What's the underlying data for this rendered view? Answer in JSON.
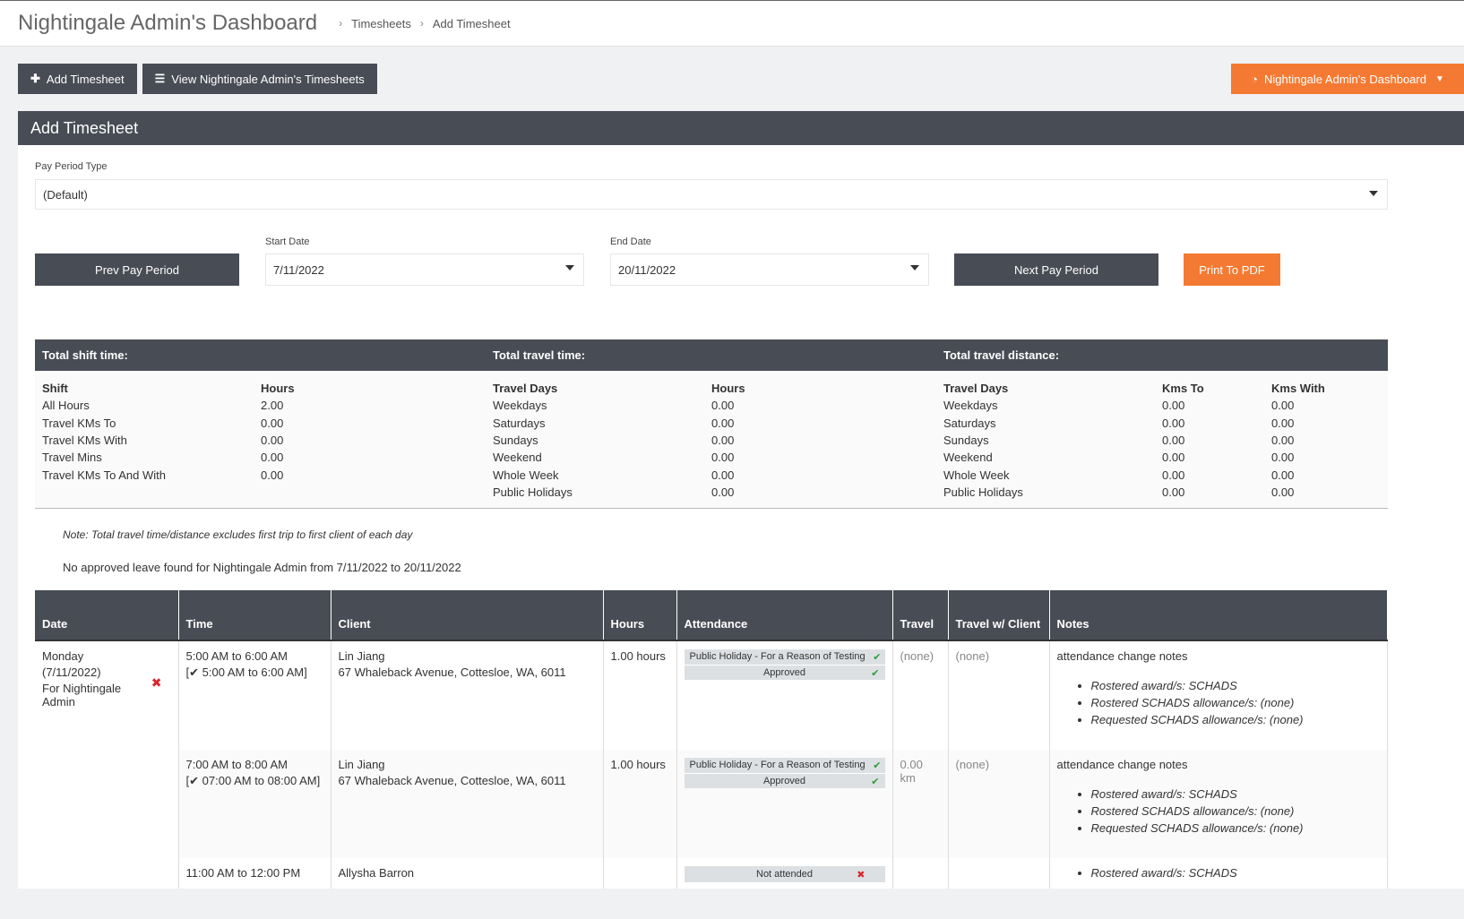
{
  "header": {
    "title": "Nightingale Admin's Dashboard",
    "breadcrumbs": [
      "Timesheets",
      "Add Timesheet"
    ]
  },
  "toolbar": {
    "add_label": "Add Timesheet",
    "view_label": "View Nightingale Admin's Timesheets",
    "dashboard_label": "Nightingale Admin's Dashboard"
  },
  "panel": {
    "title": "Add Timesheet",
    "pay_period_label": "Pay Period Type",
    "pay_period_value": "(Default)",
    "prev_label": "Prev Pay Period",
    "start_label": "Start Date",
    "start_value": "7/11/2022",
    "end_label": "End Date",
    "end_value": "20/11/2022",
    "next_label": "Next Pay Period",
    "print_label": "Print To PDF"
  },
  "summary": {
    "shift_head": "Total shift time:",
    "travel_time_head": "Total travel time:",
    "travel_dist_head": "Total travel distance:",
    "shift_cols": [
      "Shift",
      "Hours"
    ],
    "shift_rows": [
      [
        "All Hours",
        "2.00"
      ],
      [
        "Travel KMs To",
        "0.00"
      ],
      [
        "Travel KMs With",
        "0.00"
      ],
      [
        "Travel Mins",
        "0.00"
      ],
      [
        "Travel KMs To And With",
        "0.00"
      ]
    ],
    "time_cols": [
      "Travel Days",
      "Hours"
    ],
    "time_rows": [
      [
        "Weekdays",
        "0.00"
      ],
      [
        "Saturdays",
        "0.00"
      ],
      [
        "Sundays",
        "0.00"
      ],
      [
        "Weekend",
        "0.00"
      ],
      [
        "Whole Week",
        "0.00"
      ],
      [
        "Public Holidays",
        "0.00"
      ]
    ],
    "dist_cols": [
      "Travel Days",
      "Kms To",
      "Kms With"
    ],
    "dist_rows": [
      [
        "Weekdays",
        "0.00",
        "0.00"
      ],
      [
        "Saturdays",
        "0.00",
        "0.00"
      ],
      [
        "Sundays",
        "0.00",
        "0.00"
      ],
      [
        "Weekend",
        "0.00",
        "0.00"
      ],
      [
        "Whole Week",
        "0.00",
        "0.00"
      ],
      [
        "Public Holidays",
        "0.00",
        "0.00"
      ]
    ],
    "note": "Note: Total travel time/distance excludes first trip to first client of each day",
    "leave": "No approved leave found for Nightingale Admin from 7/11/2022 to 20/11/2022"
  },
  "table": {
    "cols": {
      "date": "Date",
      "time": "Time",
      "client": "Client",
      "hours": "Hours",
      "attendance": "Attendance",
      "travel": "Travel",
      "travel_with": "Travel w/ Client",
      "notes": "Notes"
    },
    "day": {
      "weekday": "Monday",
      "date": "(7/11/2022)",
      "for": "For Nightingale Admin"
    },
    "rows": [
      {
        "time": "5:00 AM to 6:00 AM",
        "actual": "5:00 AM to 6:00 AM]",
        "client": "Lin Jiang",
        "address": "67 Whaleback Avenue, Cottesloe, WA, 6011",
        "hours": "1.00 hours",
        "att_reason": "Public Holiday - For a Reason of Testing",
        "att_status": "Approved",
        "travel": "(none)",
        "travel_with": "(none)",
        "notes": "attendance change notes",
        "bullets": [
          "Rostered award/s: SCHADS",
          "Rostered SCHADS allowance/s: (none)",
          "Requested SCHADS allowance/s: (none)"
        ]
      },
      {
        "time": "7:00 AM to 8:00 AM",
        "actual": "07:00 AM to 08:00 AM]",
        "client": "Lin Jiang",
        "address": "67 Whaleback Avenue, Cottesloe, WA, 6011",
        "hours": "1.00 hours",
        "att_reason": "Public Holiday - For a Reason of Testing",
        "att_status": "Approved",
        "travel": "0.00 km",
        "travel_with": "(none)",
        "notes": "attendance change notes",
        "bullets": [
          "Rostered award/s: SCHADS",
          "Rostered SCHADS allowance/s: (none)",
          "Requested SCHADS allowance/s: (none)"
        ]
      },
      {
        "time": "11:00 AM to 12:00 PM",
        "client": "Allysha Barron",
        "att_status": "Not attended",
        "bullets": [
          "Rostered award/s: SCHADS"
        ]
      }
    ]
  },
  "colors": {
    "dark": "#484c54",
    "accent": "#f47a33",
    "ok": "#2a9d3a",
    "bad": "#d9262c"
  },
  "icons": [
    "plus-icon",
    "list-icon",
    "dashboard-icon",
    "caret-down-icon",
    "check-icon",
    "cross-icon"
  ]
}
